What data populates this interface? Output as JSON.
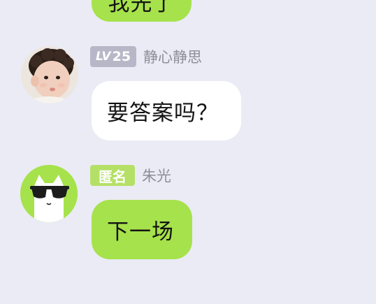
{
  "messages": [
    {
      "text": "我先了"
    },
    {
      "level_prefix": "LV",
      "level_number": "25",
      "username": "静心静思",
      "text": "要答案吗？",
      "avatar_icon": "baby-photo-avatar"
    },
    {
      "badge": "匿名",
      "username": "朱光",
      "text": "下一场",
      "avatar_icon": "sunglasses-cat-avatar"
    }
  ],
  "colors": {
    "background": "#ebebf5",
    "green_bubble": "#a6e24b",
    "white_bubble": "#ffffff",
    "level_badge": "#b7b7c7",
    "anon_badge": "#b5e067",
    "username": "#8e8e99"
  }
}
